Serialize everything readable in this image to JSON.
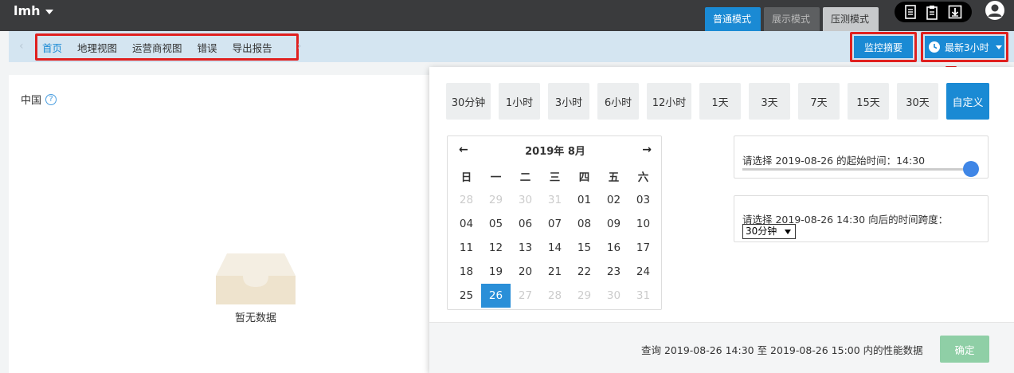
{
  "app": {
    "user_name": "lmh"
  },
  "modes": [
    "普通模式",
    "展示模式",
    "压测模式"
  ],
  "nav": {
    "items": [
      "首页",
      "地理视图",
      "运营商视图",
      "错误",
      "导出报告"
    ],
    "active_index": 0
  },
  "toolbar": {
    "summary_label": "监控摘要",
    "range_label": "最新3小时"
  },
  "region": {
    "title": "中国",
    "help": "?"
  },
  "empty": {
    "text": "暂无数据"
  },
  "quick_ranges": [
    "30分钟",
    "1小时",
    "3小时",
    "6小时",
    "12小时",
    "1天",
    "3天",
    "7天",
    "15天",
    "30天",
    "自定义"
  ],
  "quick_active_index": 10,
  "calendar": {
    "title": "2019年 8月",
    "prev": "←",
    "next": "→",
    "weekdays": [
      "日",
      "一",
      "二",
      "三",
      "四",
      "五",
      "六"
    ],
    "days": [
      [
        "28",
        "29",
        "30",
        "31",
        "01",
        "02",
        "03"
      ],
      [
        "04",
        "05",
        "06",
        "07",
        "08",
        "09",
        "10"
      ],
      [
        "11",
        "12",
        "13",
        "14",
        "15",
        "16",
        "17"
      ],
      [
        "18",
        "19",
        "20",
        "21",
        "22",
        "23",
        "24"
      ],
      [
        "25",
        "26",
        "27",
        "28",
        "29",
        "30",
        "31"
      ]
    ],
    "dim_first_row": 4,
    "selected": "26",
    "dim_after_selected": true
  },
  "start_time": {
    "label": "请选择 2019-08-26 的起始时间：14:30",
    "slider_value": 1.0
  },
  "span": {
    "label": "请选择 2019-08-26 14:30 向后的时间跨度：",
    "selected": "30分钟"
  },
  "footer": {
    "query": "查询 2019-08-26 14:30 至 2019-08-26 15:00 内的性能数据",
    "confirm": "确定"
  },
  "colors": {
    "primary": "#1a8ad4",
    "highlight_red": "#e0201f",
    "confirm": "#8fcfa6",
    "nav_bg": "#d4e5f1"
  }
}
